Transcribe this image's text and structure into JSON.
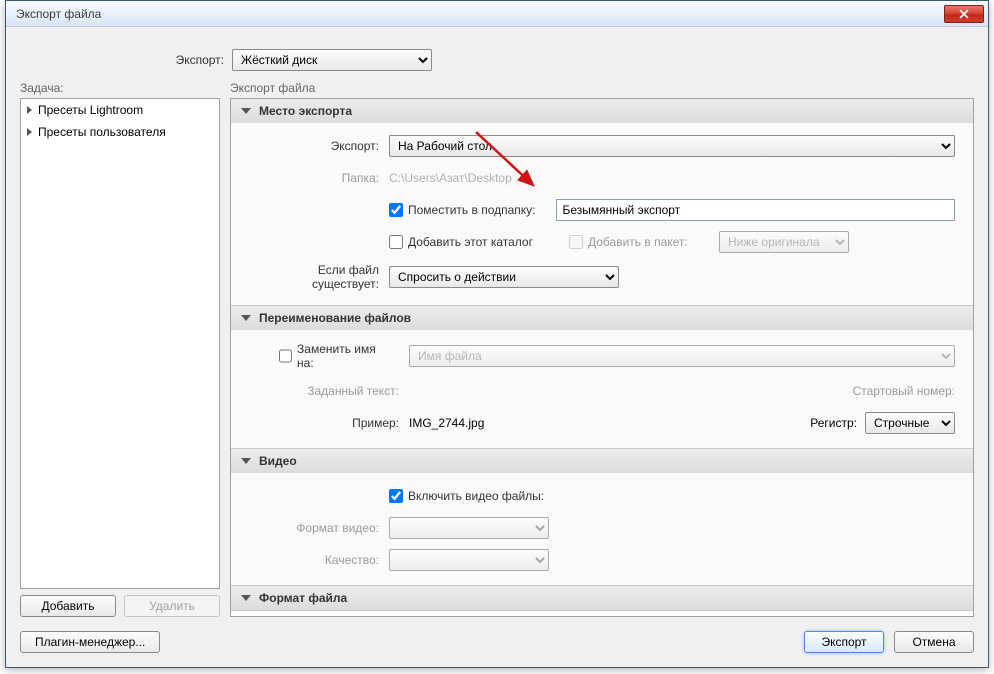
{
  "title": "Экспорт файла",
  "topbar": {
    "label": "Экспорт:",
    "value": "Жёсткий диск"
  },
  "leftcol": {
    "head": "Задача:",
    "presets": [
      "Пресеты Lightroom",
      "Пресеты пользователя"
    ],
    "add": "Добавить",
    "remove": "Удалить"
  },
  "rightcol": {
    "head": "Экспорт файла"
  },
  "loc": {
    "title": "Место экспорта",
    "export_label": "Экспорт:",
    "export_value": "На Рабочий стол",
    "folder_label": "Папка:",
    "folder_value": "C:\\Users\\Азат\\Desktop",
    "subfolder_chk": "Поместить в подпапку:",
    "subfolder_value": "Безымянный экспорт",
    "addcatalog_chk": "Добавить этот каталог",
    "addstack_chk": "Добавить в пакет:",
    "stack_value": "Ниже оригинала",
    "exists_label": "Если файл существует:",
    "exists_value": "Спросить о действии"
  },
  "ren": {
    "title": "Переименование файлов",
    "rename_chk": "Заменить имя на:",
    "template_value": "Имя файла",
    "customtext_label": "Заданный текст:",
    "startnum_label": "Стартовый номер:",
    "example_label": "Пример:",
    "example_value": "IMG_2744.jpg",
    "case_label": "Регистр:",
    "case_value": "Строчные"
  },
  "vid": {
    "title": "Видео",
    "include_chk": "Включить видео файлы:",
    "format_label": "Формат видео:",
    "quality_label": "Качество:"
  },
  "fmt": {
    "title": "Формат файла"
  },
  "footer": {
    "plugin": "Плагин-менеджер...",
    "export": "Экспорт",
    "cancel": "Отмена"
  }
}
